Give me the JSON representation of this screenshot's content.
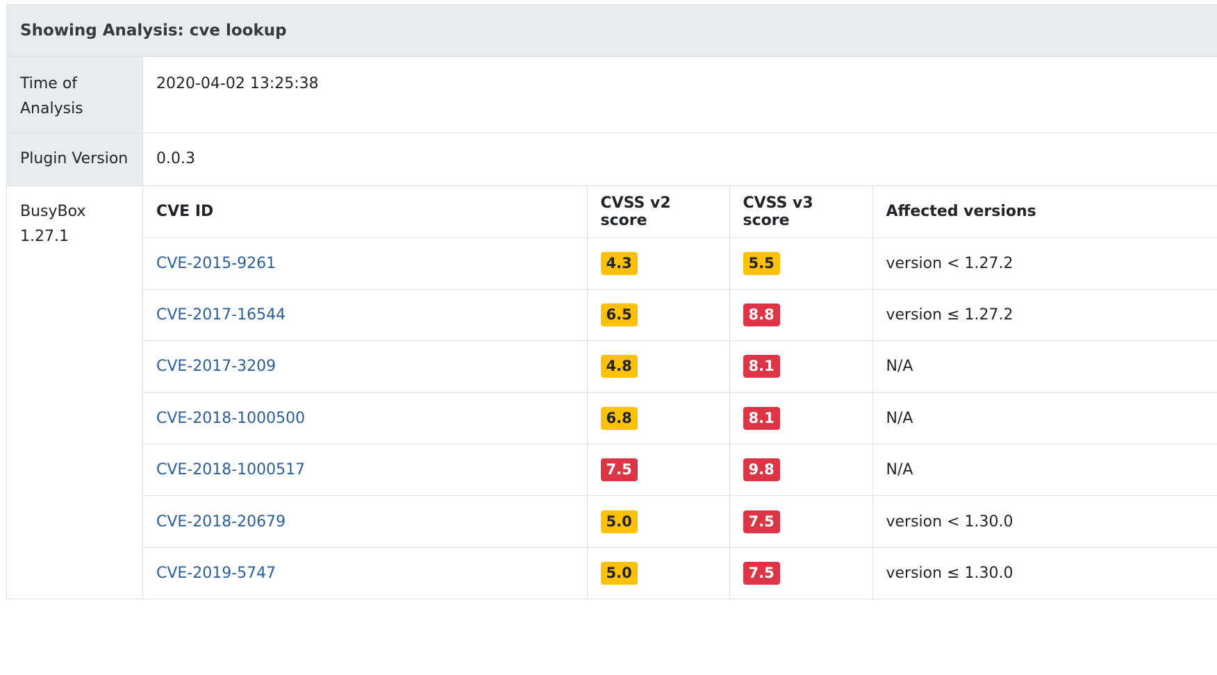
{
  "analysis": {
    "header": "Showing Analysis: cve lookup",
    "time_label": "Time of Analysis",
    "time_value": "2020-04-02 13:25:38",
    "plugin_label": "Plugin Version",
    "plugin_value": "0.0.3",
    "component": "BusyBox 1.27.1"
  },
  "colors": {
    "warning": "#ffc107",
    "danger": "#dc3545",
    "link": "#2a5e9a",
    "header_bg": "#e9ecef"
  },
  "table": {
    "headers": [
      "CVE ID",
      "CVSS v2 score",
      "CVSS v3 score",
      "Affected versions"
    ],
    "rows": [
      {
        "id": "CVE-2015-9261",
        "v2": "4.3",
        "v2_level": "warning",
        "v3": "5.5",
        "v3_level": "warning",
        "affected": "version < 1.27.2"
      },
      {
        "id": "CVE-2017-16544",
        "v2": "6.5",
        "v2_level": "warning",
        "v3": "8.8",
        "v3_level": "danger",
        "affected": "version ≤ 1.27.2"
      },
      {
        "id": "CVE-2017-3209",
        "v2": "4.8",
        "v2_level": "warning",
        "v3": "8.1",
        "v3_level": "danger",
        "affected": "N/A"
      },
      {
        "id": "CVE-2018-1000500",
        "v2": "6.8",
        "v2_level": "warning",
        "v3": "8.1",
        "v3_level": "danger",
        "affected": "N/A"
      },
      {
        "id": "CVE-2018-1000517",
        "v2": "7.5",
        "v2_level": "danger",
        "v3": "9.8",
        "v3_level": "danger",
        "affected": "N/A"
      },
      {
        "id": "CVE-2018-20679",
        "v2": "5.0",
        "v2_level": "warning",
        "v3": "7.5",
        "v3_level": "danger",
        "affected": "version < 1.30.0"
      },
      {
        "id": "CVE-2019-5747",
        "v2": "5.0",
        "v2_level": "warning",
        "v3": "7.5",
        "v3_level": "danger",
        "affected": "version ≤ 1.30.0"
      }
    ]
  }
}
